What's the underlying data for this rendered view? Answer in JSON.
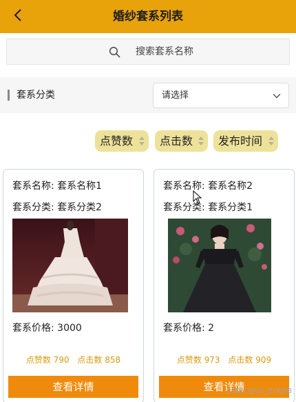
{
  "header": {
    "title": "婚纱套系列表",
    "back_icon": "chevron-left-icon"
  },
  "search": {
    "placeholder": "搜索套系名称",
    "icon": "search-icon"
  },
  "filter": {
    "label": "套系分类",
    "select_value": "请选择",
    "chevron_icon": "chevron-down-icon"
  },
  "sort": {
    "buttons": [
      {
        "label": "点赞数"
      },
      {
        "label": "点击数"
      },
      {
        "label": "发布时间"
      }
    ],
    "button_color": "#ede29a"
  },
  "cards": [
    {
      "name_line": "套系名称: 套系名称1",
      "category_line": "套系分类: 套系分类2",
      "price_line": "套系价格: 3000",
      "likes_line": "点赞数 790",
      "clicks_line": "点击数 858",
      "detail_label": "查看详情"
    },
    {
      "name_line": "套系名称: 套系名称2",
      "category_line": "套系分类: 套系分类1",
      "price_line": "套系价格: 2",
      "likes_line": "点赞数 973",
      "clicks_line": "点击数 909",
      "detail_label": "查看详情"
    }
  ],
  "watermark": "CSDN @VX_ZYKJ98",
  "colors": {
    "header": "#e8a20a",
    "stats": "#d89a10",
    "detail_button": "#f08a0c"
  }
}
